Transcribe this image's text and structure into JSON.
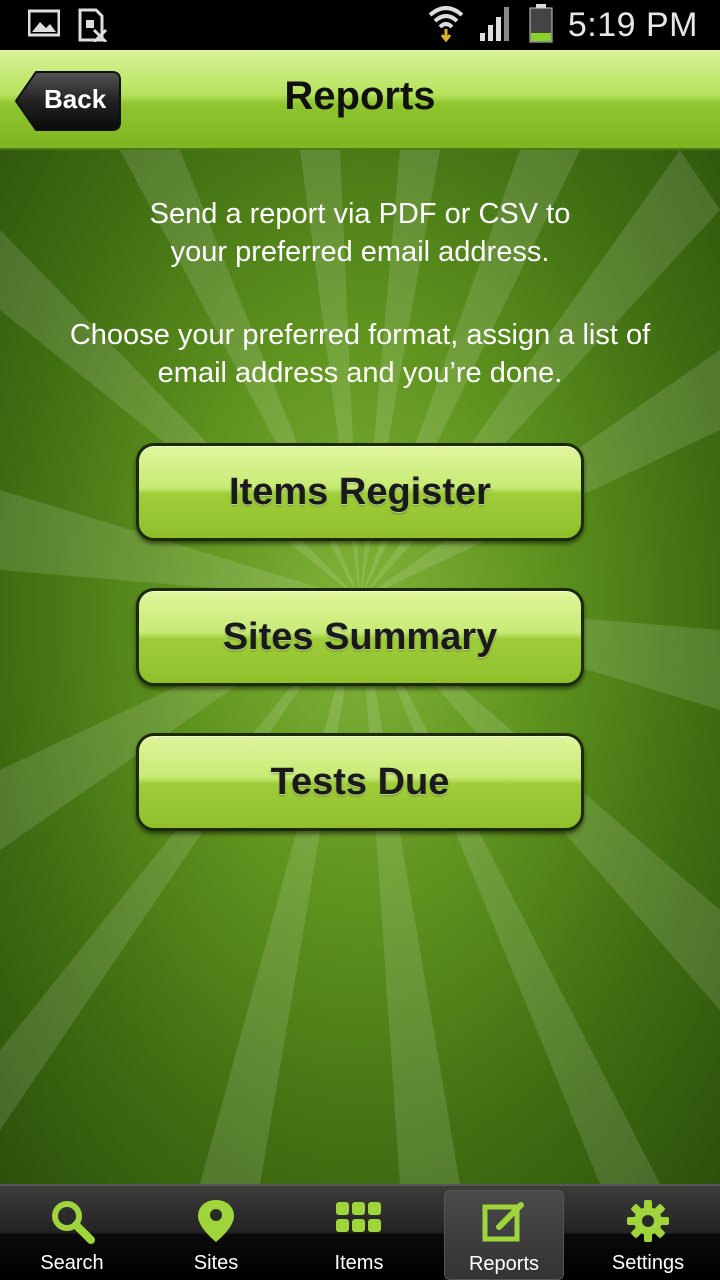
{
  "status_bar": {
    "time": "5:19 PM"
  },
  "header": {
    "back_label": "Back",
    "title": "Reports"
  },
  "main": {
    "intro_line1": "Send a report via PDF or CSV to",
    "intro_line2": "your preferred email address.",
    "intro_line3": "Choose your preferred format, assign a list of",
    "intro_line4": "email address and you’re done.",
    "buttons": [
      "Items Register",
      "Sites Summary",
      "Tests Due"
    ]
  },
  "tabs": [
    {
      "label": "Search",
      "icon": "magnifier-icon"
    },
    {
      "label": "Sites",
      "icon": "map-pin-icon"
    },
    {
      "label": "Items",
      "icon": "grid-icon"
    },
    {
      "label": "Reports",
      "icon": "edit-icon",
      "active": true
    },
    {
      "label": "Settings",
      "icon": "gear-icon"
    }
  ],
  "colors": {
    "accent": "#9fcd3a",
    "background": "#4f8417",
    "tab_icon": "#9fd43a"
  }
}
